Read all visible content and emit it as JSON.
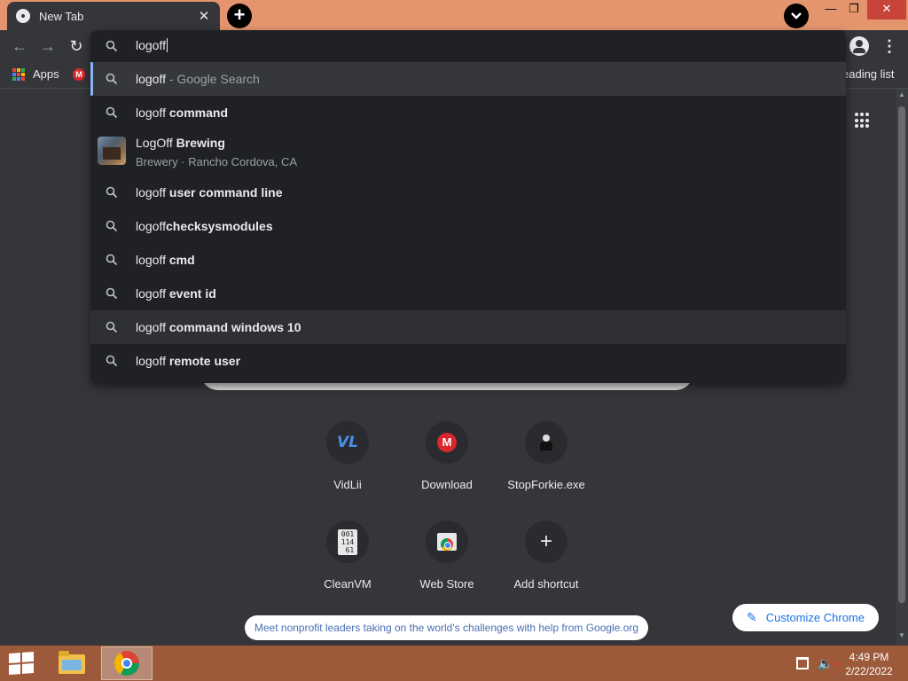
{
  "window": {
    "tab_title": "New Tab",
    "tab_close": "✕",
    "new_tab_label": "+",
    "minimize": "—",
    "maximize": "❐",
    "close": "✕"
  },
  "toolbar": {
    "back": "←",
    "forward": "→",
    "reload": "↻",
    "menu": "⋮"
  },
  "bookmarks": {
    "apps_label": "Apps",
    "mega_letter": "M",
    "reading_list": "eading list",
    "apps_colors": [
      "#ea4335",
      "#fbbc05",
      "#34a853",
      "#4285f4",
      "#ea4335",
      "#fbbc05",
      "#34a853",
      "#4285f4",
      "#ea4335"
    ]
  },
  "omnibox": {
    "input_value": "logoff",
    "suggestions": [
      {
        "prefix": "logoff",
        "bold": "",
        "desc": " - Google Search",
        "state": "selected"
      },
      {
        "prefix": "logoff",
        "bold": " command",
        "desc": "",
        "state": ""
      },
      {
        "prefix": "logoff",
        "bold": " user command line",
        "desc": "",
        "state": ""
      },
      {
        "prefix": "logoff",
        "bold": "checksysmodules",
        "desc": "",
        "state": ""
      },
      {
        "prefix": "logoff",
        "bold": " cmd",
        "desc": "",
        "state": ""
      },
      {
        "prefix": "logoff",
        "bold": " event id",
        "desc": "",
        "state": ""
      },
      {
        "prefix": "logoff",
        "bold": " command windows 10",
        "desc": "",
        "state": "hover"
      },
      {
        "prefix": "logoff",
        "bold": " remote user",
        "desc": "",
        "state": ""
      }
    ],
    "entity": {
      "title_prefix": "LogOff",
      "title_bold": " Brewing",
      "subtitle": "Brewery · Rancho Cordova, CA"
    }
  },
  "shortcuts": [
    {
      "label": "VidLii",
      "icon": "vidlii-icon",
      "glyph": "VL"
    },
    {
      "label": "Download",
      "icon": "mega-icon",
      "glyph": "M"
    },
    {
      "label": "StopForkie.exe",
      "icon": "stopforkie-icon",
      "glyph": ""
    },
    {
      "label": "CleanVM",
      "icon": "cleanvm-icon",
      "glyph": "001\n114\n61"
    },
    {
      "label": "Web Store",
      "icon": "web-store-icon",
      "glyph": ""
    },
    {
      "label": "Add shortcut",
      "icon": "plus-icon",
      "glyph": "+"
    }
  ],
  "customize": {
    "label": "Customize Chrome",
    "pencil": "✎"
  },
  "promo": "Meet nonprofit leaders taking on the world's challenges with help from Google.org",
  "taskbar": {
    "time": "4:49 PM",
    "date": "2/22/2022",
    "volume_glyph": "🔈"
  },
  "colors": {
    "titlebar": "#e4956d",
    "taskbar": "#9c5a3a",
    "omnibox_bg": "#202124",
    "accent": "#8ab4f8"
  }
}
